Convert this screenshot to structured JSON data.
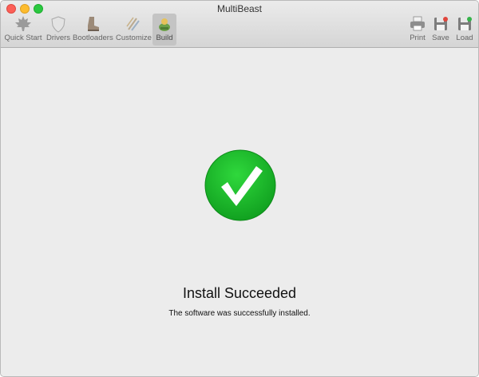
{
  "window": {
    "title": "MultiBeast"
  },
  "toolbar": {
    "left": [
      {
        "label": "Quick Start",
        "icon": "maple-leaf-icon"
      },
      {
        "label": "Drivers",
        "icon": "shield-icon"
      },
      {
        "label": "Bootloaders",
        "icon": "boot-icon"
      },
      {
        "label": "Customize",
        "icon": "paintbrush-icon"
      },
      {
        "label": "Build",
        "icon": "build-icon",
        "active": true
      }
    ],
    "right": [
      {
        "label": "Print",
        "icon": "printer-icon"
      },
      {
        "label": "Save",
        "icon": "save-icon"
      },
      {
        "label": "Load",
        "icon": "load-icon"
      }
    ]
  },
  "result": {
    "title": "Install Succeeded",
    "message": "The software was successfully installed.",
    "status_icon": "checkmark-icon",
    "status_color": "#1fbc2e"
  }
}
